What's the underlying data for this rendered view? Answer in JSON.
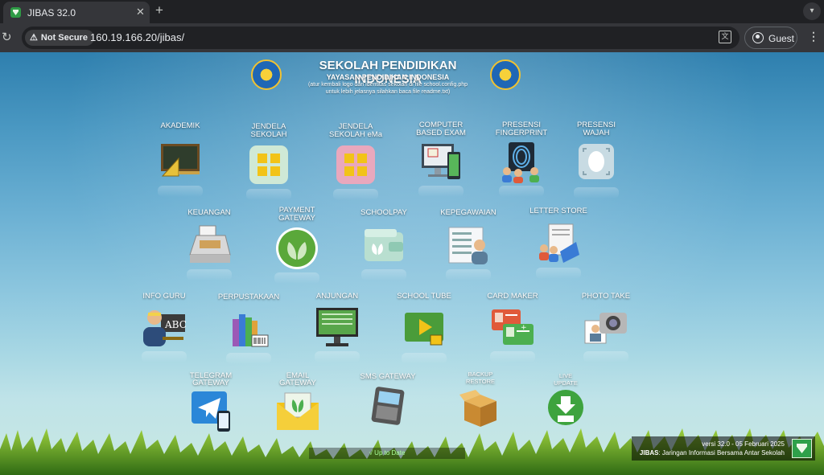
{
  "browser": {
    "tab_title": "JIBAS 32.0",
    "security_label": "Not Secure",
    "url": "160.19.166.20/jibas/",
    "profile_label": "Guest"
  },
  "header": {
    "school_name": "SEKOLAH PENDIDIKAN INDONESIA",
    "foundation": "YAYASAN PENDIDIKAN INDONESIA",
    "note_line1": "(atur kembali logo dan identitas sekolah di file school.config.php",
    "note_line2": "untuk lebih jelasnya silahkan baca file readme.txt)"
  },
  "apps": {
    "akademik": "AKADEMIK",
    "jendela_sekolah_1": "JENDELA",
    "jendela_sekolah_2": "SEKOLAH",
    "jendela_ema_1": "JENDELA",
    "jendela_ema_2": "SEKOLAH eMa",
    "cbe_1": "COMPUTER",
    "cbe_2": "BASED EXAM",
    "fingerprint_1": "PRESENSI",
    "fingerprint_2": "FINGERPRINT",
    "wajah_1": "PRESENSI",
    "wajah_2": "WAJAH",
    "keuangan": "KEUANGAN",
    "payment_1": "PAYMENT",
    "payment_2": "GATEWAY",
    "schoolpay": "SCHOOLPAY",
    "kepegawaian": "KEPEGAWAIAN",
    "letter_store": "LETTER STORE",
    "info_guru": "INFO GURU",
    "perpustakaan": "PERPUSTAKAAN",
    "anjungan": "ANJUNGAN",
    "school_tube": "SCHOOL TUBE",
    "card_maker": "CARD MAKER",
    "photo_take": "PHOTO TAKE",
    "telegram_1": "TELEGRAM",
    "telegram_2": "GATEWAY",
    "email_1": "EMAIL",
    "email_2": "GATEWAY",
    "sms_gateway": "SMS GATEWAY",
    "backup_1": "BACKUP",
    "backup_2": "RESTORE",
    "live_1": "LIVE",
    "live_2": "UPDATE"
  },
  "status": {
    "update_status": "√ Up to Date",
    "version": "versi 32.0 - 05 Februari 2025",
    "footer_brand": "JIBAS",
    "footer_desc": ": Jaringan Informasi Bersama Antar Sekolah"
  },
  "colors": {
    "sky_top": "#2e7fae",
    "sky_bottom": "#c9e8e2",
    "accent_green": "#2fa04a"
  }
}
